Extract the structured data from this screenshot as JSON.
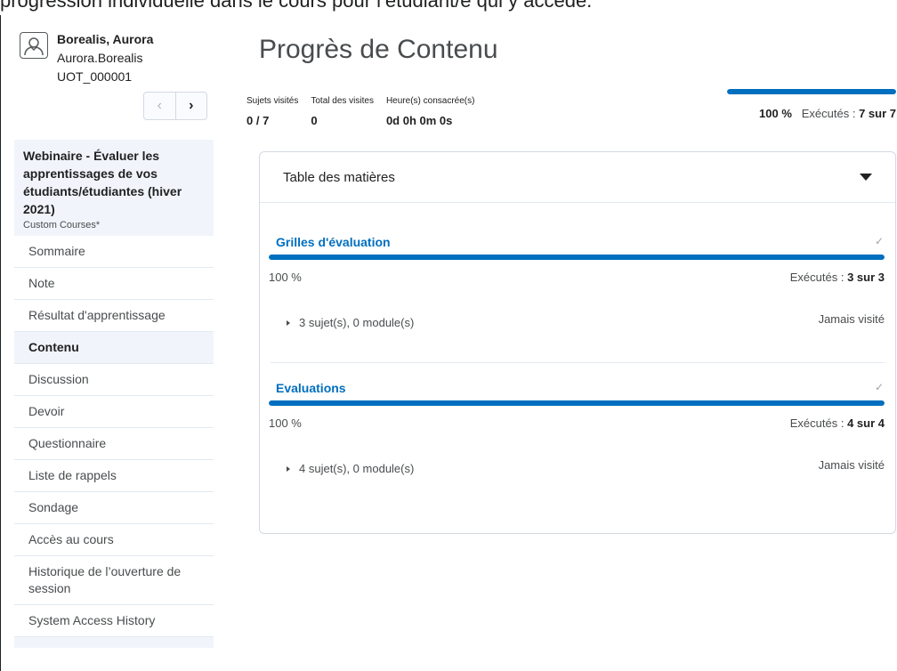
{
  "caption": "progression individuelle dans le cours pour l’étudiant/e qui y accède.",
  "user": {
    "name": "Borealis, Aurora",
    "login": "Aurora.Borealis",
    "id": "UOT_000001",
    "prev_icon": "chevron-left-icon",
    "next_icon": "chevron-right-icon"
  },
  "course": {
    "title": "Webinaire - Évaluer les apprentissages de vos étudiants/étudiantes (hiver 2021)",
    "subtitle": "Custom Courses*"
  },
  "nav": {
    "items": [
      {
        "label": "Sommaire"
      },
      {
        "label": "Note"
      },
      {
        "label": "Résultat d'apprentissage"
      },
      {
        "label": "Contenu",
        "active": true
      },
      {
        "label": "Discussion"
      },
      {
        "label": "Devoir"
      },
      {
        "label": "Questionnaire"
      },
      {
        "label": "Liste de rappels"
      },
      {
        "label": "Sondage"
      },
      {
        "label": "Accès au cours"
      },
      {
        "label": "Historique de l’ouverture de session"
      },
      {
        "label": "System Access History"
      }
    ]
  },
  "main": {
    "title": "Progrès de Contenu",
    "stats": [
      {
        "label": "Sujets visités",
        "value": "0 / 7"
      },
      {
        "label": "Total des visites",
        "value": "0"
      },
      {
        "label": "Heure(s) consacrée(s)",
        "value": "0d 0h 0m 0s"
      }
    ],
    "overall": {
      "progress": 1.0,
      "percent": "100 %",
      "completed_prefix": "Exécutés : ",
      "completed_value": "7 sur 7"
    },
    "toc": {
      "title": "Table des matières",
      "caret_icon": "caret-down-icon",
      "modules": [
        {
          "title": "Grilles d'évaluation",
          "check": "✓",
          "progress": 1.0,
          "percent": "100 %",
          "completed_prefix": "Exécutés : ",
          "completed_value": "3 sur 3",
          "topics": "3 sujet(s), 0 module(s)",
          "status": "Jamais visité"
        },
        {
          "title": "Evaluations",
          "check": "✓",
          "progress": 1.0,
          "percent": "100 %",
          "completed_prefix": "Exécutés : ",
          "completed_value": "4 sur 4",
          "topics": "4 sujet(s), 0 module(s)",
          "status": "Jamais visité"
        }
      ]
    }
  },
  "colors": {
    "accent": "#006fbf",
    "sidebar_highlight": "#f1f5fb",
    "text": "#494c4e"
  }
}
